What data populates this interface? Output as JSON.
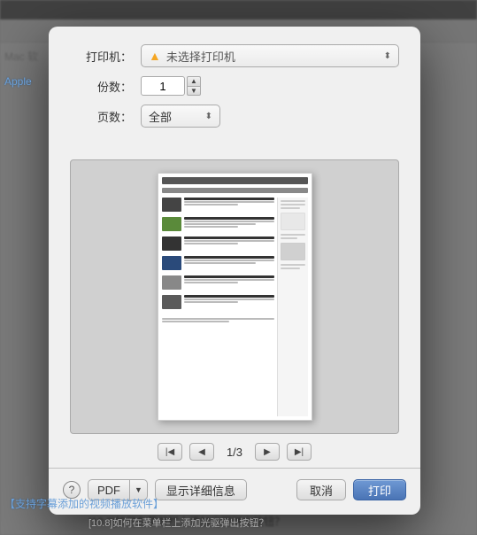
{
  "dialog": {
    "printer_label": "打印机：",
    "printer_placeholder": "未选择打印机",
    "copies_label": "份数：",
    "copies_value": "1",
    "pages_label": "页数：",
    "pages_value": "全部",
    "page_indicator": "1/3",
    "help_label": "?",
    "pdf_label": "PDF",
    "pdf_arrow": "▼",
    "detail_btn_label": "显示详细信息",
    "cancel_btn_label": "取消",
    "print_btn_label": "打印"
  },
  "background": {
    "apple_text": "Apple",
    "mac_text": "Mac 软",
    "bottom_text1": "【支持字幕添加的视频播放软件】",
    "bottom_text2": "[10.8]如何在菜单栏上添加光驱弹出按钮？"
  }
}
